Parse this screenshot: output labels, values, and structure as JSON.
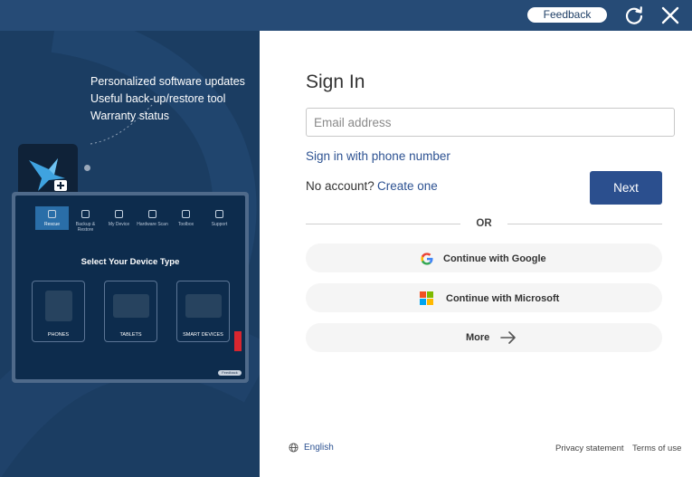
{
  "titlebar": {
    "feedback_label": "Feedback",
    "refresh_icon": "refresh-icon",
    "close_icon": "close-icon",
    "background": "#264b76"
  },
  "left_panel": {
    "background": "#1b3d62",
    "features": [
      "Personalized software updates",
      "Useful back-up/restore tool",
      "Warranty status"
    ],
    "preview": {
      "nav": [
        "Rescue",
        "Backup & Restore",
        "My Device",
        "Hardware Scan",
        "Toolbox",
        "Support"
      ],
      "heading": "Select Your Device Type",
      "devices": [
        "PHONES",
        "TABLETS",
        "SMART DEVICES"
      ],
      "brand": "Lenovo",
      "feedback": "Feedback"
    }
  },
  "signin": {
    "title": "Sign In",
    "email_placeholder": "Email address",
    "email_value": "",
    "phone_link": "Sign in with phone number",
    "no_account": "No account?",
    "create_link": "Create one",
    "next_label": "Next",
    "or_label": "OR",
    "google_label": "Continue with Google",
    "microsoft_label": "Continue with Microsoft",
    "more_label": "More",
    "accent_color": "#2b4f8e"
  },
  "footer": {
    "language": "English",
    "privacy": "Privacy statement",
    "terms": "Terms of use"
  }
}
